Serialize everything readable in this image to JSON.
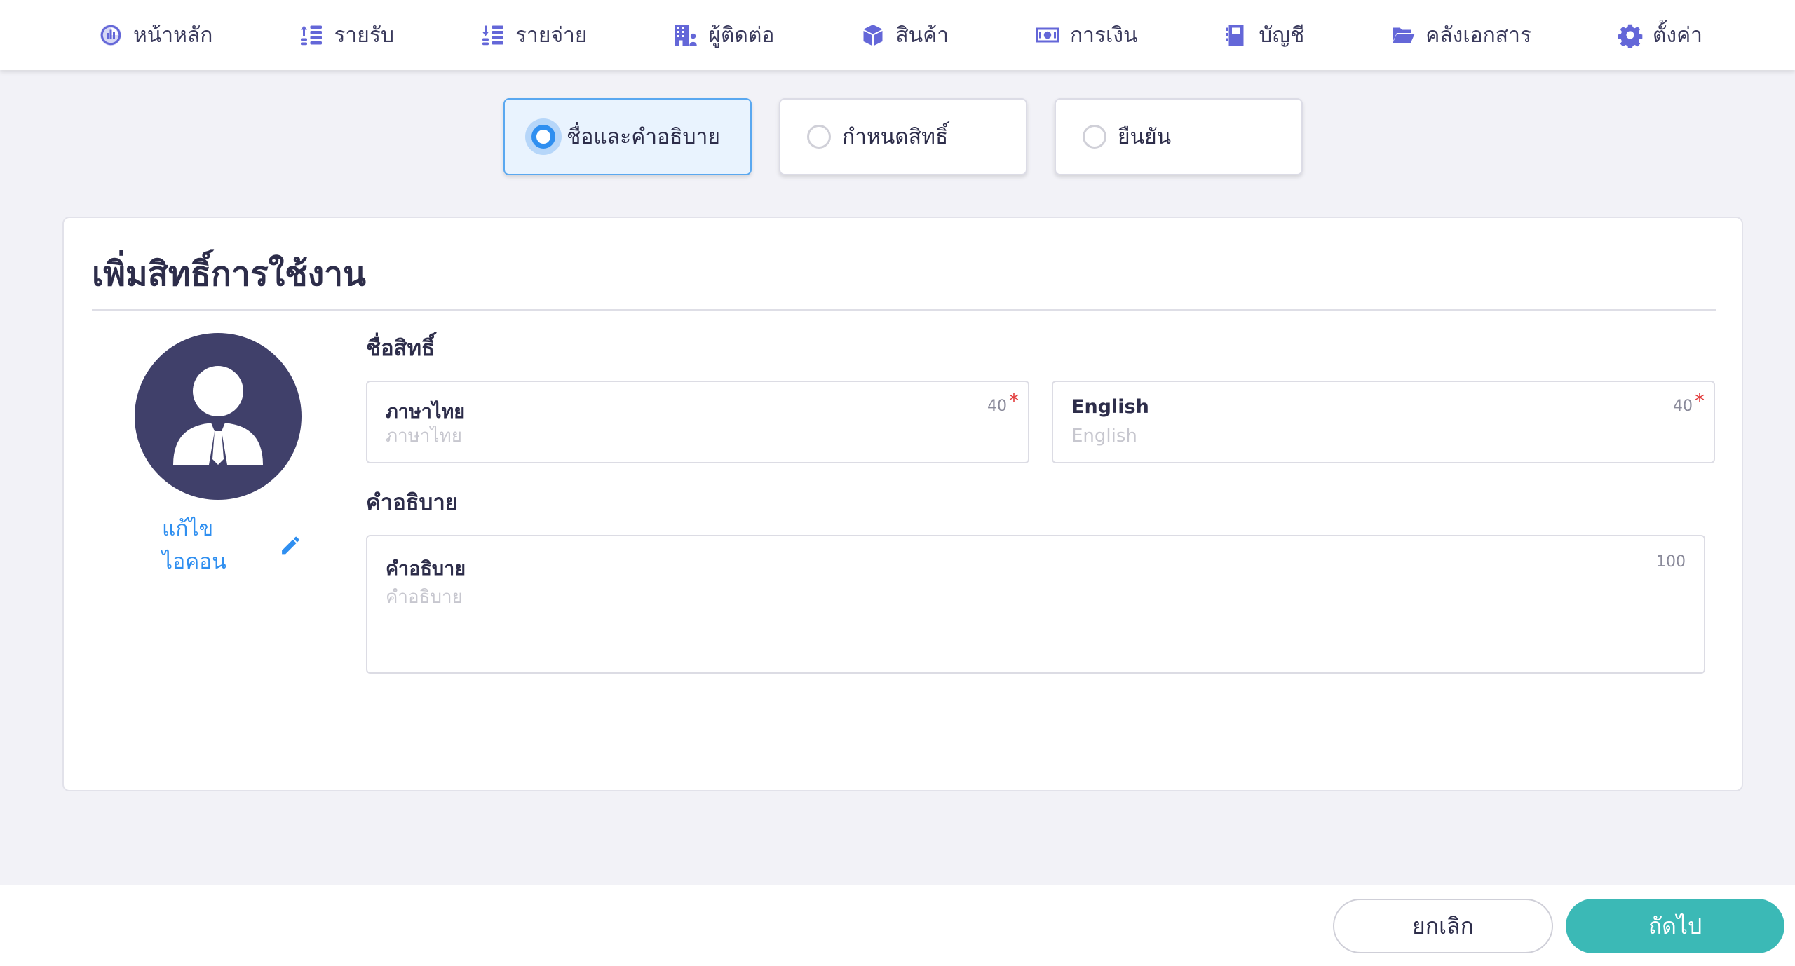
{
  "nav": {
    "items": [
      {
        "label": "หน้าหลัก",
        "icon": "chart-pie-icon"
      },
      {
        "label": "รายรับ",
        "icon": "income-list-icon"
      },
      {
        "label": "รายจ่าย",
        "icon": "expense-list-icon"
      },
      {
        "label": "ผู้ติดต่อ",
        "icon": "building-contacts-icon"
      },
      {
        "label": "สินค้า",
        "icon": "box-icon"
      },
      {
        "label": "การเงิน",
        "icon": "money-icon"
      },
      {
        "label": "บัญชี",
        "icon": "book-icon"
      },
      {
        "label": "คลังเอกสาร",
        "icon": "folder-open-icon"
      },
      {
        "label": "ตั้งค่า",
        "icon": "gear-icon"
      }
    ]
  },
  "stepper": {
    "active_index": 0,
    "steps": [
      {
        "label": "ชื่อและคำอธิบาย"
      },
      {
        "label": "กำหนดสิทธิ์"
      },
      {
        "label": "ยืนยัน"
      }
    ]
  },
  "form": {
    "title": "เพิ่มสิทธิ์การใช้งาน",
    "avatar_icon": "user-tie-icon",
    "edit_icon_label": "แก้ไขไอคอน",
    "name_section": "ชื่อสิทธิ์",
    "thai_field": {
      "label": "ภาษาไทย",
      "placeholder": "ภาษาไทย",
      "max": "40",
      "required": "*"
    },
    "english_field": {
      "label": "English",
      "placeholder": "English",
      "max": "40",
      "required": "*"
    },
    "description_section": "คำอธิบาย",
    "description_field": {
      "label": "คำอธิบาย",
      "placeholder": "คำอธิบาย",
      "max": "100"
    }
  },
  "footer": {
    "cancel_label": "ยกเลิก",
    "next_label": "ถัดไป"
  },
  "colors": {
    "accent": "#6467d8",
    "primary_blue": "#2f8ff0",
    "next_button": "#3bb9b6",
    "avatar_bg": "#40406a",
    "required": "#e23b3b"
  }
}
